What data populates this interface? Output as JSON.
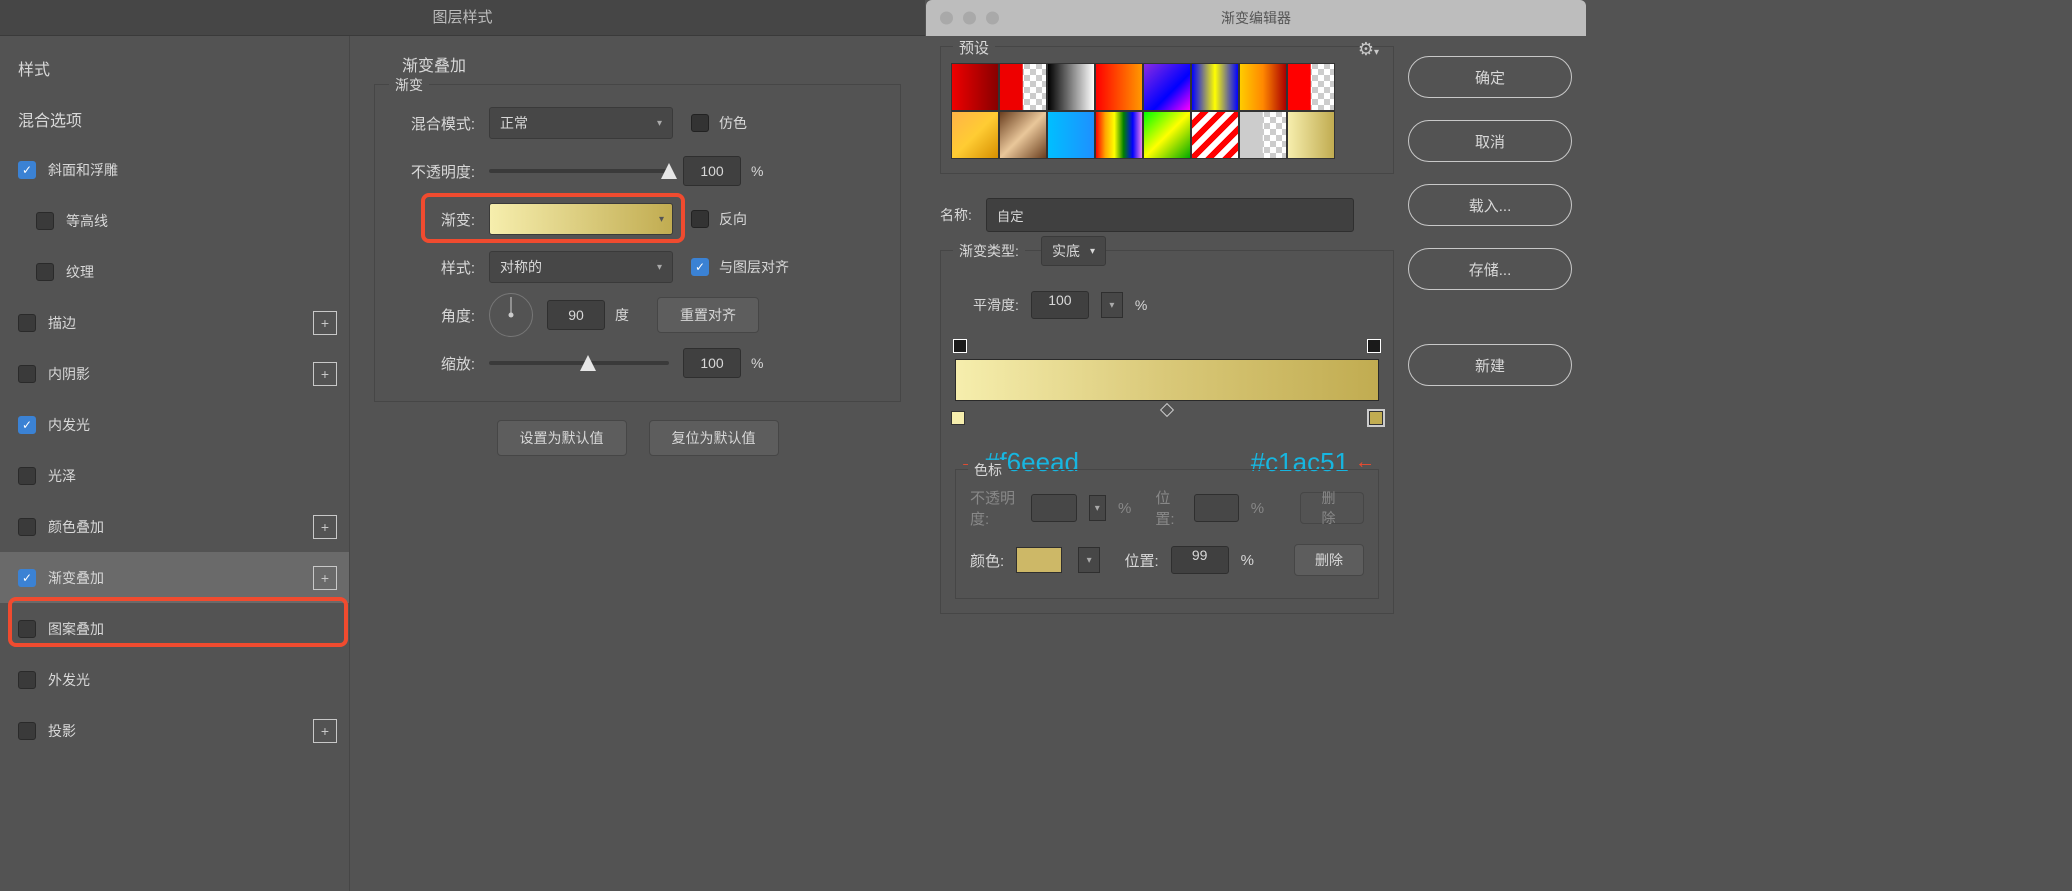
{
  "layerStyle": {
    "title": "图层样式",
    "sidebar": {
      "header1": "样式",
      "header2": "混合选项",
      "items": {
        "bevel": {
          "label": "斜面和浮雕",
          "checked": true,
          "plus": false
        },
        "contour": {
          "label": "等高线",
          "checked": false,
          "plus": false
        },
        "texture": {
          "label": "纹理",
          "checked": false,
          "plus": false
        },
        "stroke": {
          "label": "描边",
          "checked": false,
          "plus": true
        },
        "innerShadow": {
          "label": "内阴影",
          "checked": false,
          "plus": true
        },
        "innerGlow": {
          "label": "内发光",
          "checked": true,
          "plus": false
        },
        "satin": {
          "label": "光泽",
          "checked": false,
          "plus": false
        },
        "colorOverlay": {
          "label": "颜色叠加",
          "checked": false,
          "plus": true
        },
        "gradOverlay": {
          "label": "渐变叠加",
          "checked": true,
          "plus": true
        },
        "patternOverlay": {
          "label": "图案叠加",
          "checked": false,
          "plus": false
        },
        "outerGlow": {
          "label": "外发光",
          "checked": false,
          "plus": false
        },
        "dropShadow": {
          "label": "投影",
          "checked": false,
          "plus": true
        }
      }
    },
    "panel": {
      "sectionTitle": "渐变叠加",
      "fieldsetLegend": "渐变",
      "blendModeLabel": "混合模式:",
      "blendModeValue": "正常",
      "ditherLabel": "仿色",
      "opacityLabel": "不透明度:",
      "opacityValue": "100",
      "percent": "%",
      "gradientLabel": "渐变:",
      "reverseLabel": "反向",
      "styleLabel": "样式:",
      "styleValue": "对称的",
      "alignLabel": "与图层对齐",
      "angleLabel": "角度:",
      "angleValue": "90",
      "angleUnit": "度",
      "resetAlignBtn": "重置对齐",
      "scaleLabel": "缩放:",
      "scaleValue": "100",
      "makeDefaultBtn": "设置为默认值",
      "resetDefaultBtn": "复位为默认值"
    }
  },
  "gradEditor": {
    "title": "渐变编辑器",
    "presetsLegend": "预设",
    "buttons": {
      "ok": "确定",
      "cancel": "取消",
      "load": "载入...",
      "save": "存储...",
      "new": "新建"
    },
    "nameLabel": "名称:",
    "nameValue": "自定",
    "gradTypeLabel": "渐变类型:",
    "gradTypeValue": "实底",
    "smoothLabel": "平滑度:",
    "smoothValue": "100",
    "percent": "%",
    "annotLeft": "#f6eead",
    "annotRight": "#c1ac51",
    "stopsLegend": "色标",
    "opacityRow": {
      "label": "不透明度:",
      "posLabel": "位置:",
      "deleteLabel": "删除"
    },
    "colorRow": {
      "label": "颜色:",
      "posLabel": "位置:",
      "posValue": "99",
      "deleteLabel": "删除"
    },
    "swatches": [
      "linear-gradient(90deg,#e00,#800)",
      "linear-gradient(90deg,#e00,#e00 49%,transparent 50%),repeating-conic-gradient(#ccc 0 25%,#fff 0 50%) 0/12px 12px",
      "linear-gradient(90deg,#000,#fff)",
      "linear-gradient(90deg,#f00,#f90)",
      "linear-gradient(135deg,#8a2be2,#00f 60%,#f0f)",
      "linear-gradient(90deg,#00f,#ff0,#00f)",
      "linear-gradient(90deg,#fc0,#f80,#a00)",
      "linear-gradient(90deg,#f00,#f00 49%,transparent 50%),repeating-conic-gradient(#ccc 0 25%,#fff 0 50%) 0/12px 12px",
      "linear-gradient(135deg,#ffb347,#ffcc33,#d68f00)",
      "linear-gradient(135deg,#6a3e1f,#e9c79a,#6a3e1f)",
      "linear-gradient(90deg,#00bfff,#1e90ff)",
      "linear-gradient(90deg,red,orange,yellow,green,blue,violet)",
      "linear-gradient(135deg,#0f0,#ff0,#0a0)",
      "repeating-linear-gradient(135deg,#fff 0 6px,#f00 6px 12px)",
      "linear-gradient(90deg,#ccc,#ccc 49%,transparent 50%),repeating-conic-gradient(#ccc 0 25%,#fff 0 50%) 0/12px 12px",
      "linear-gradient(90deg,#f6eead,#c1ac51)"
    ]
  }
}
